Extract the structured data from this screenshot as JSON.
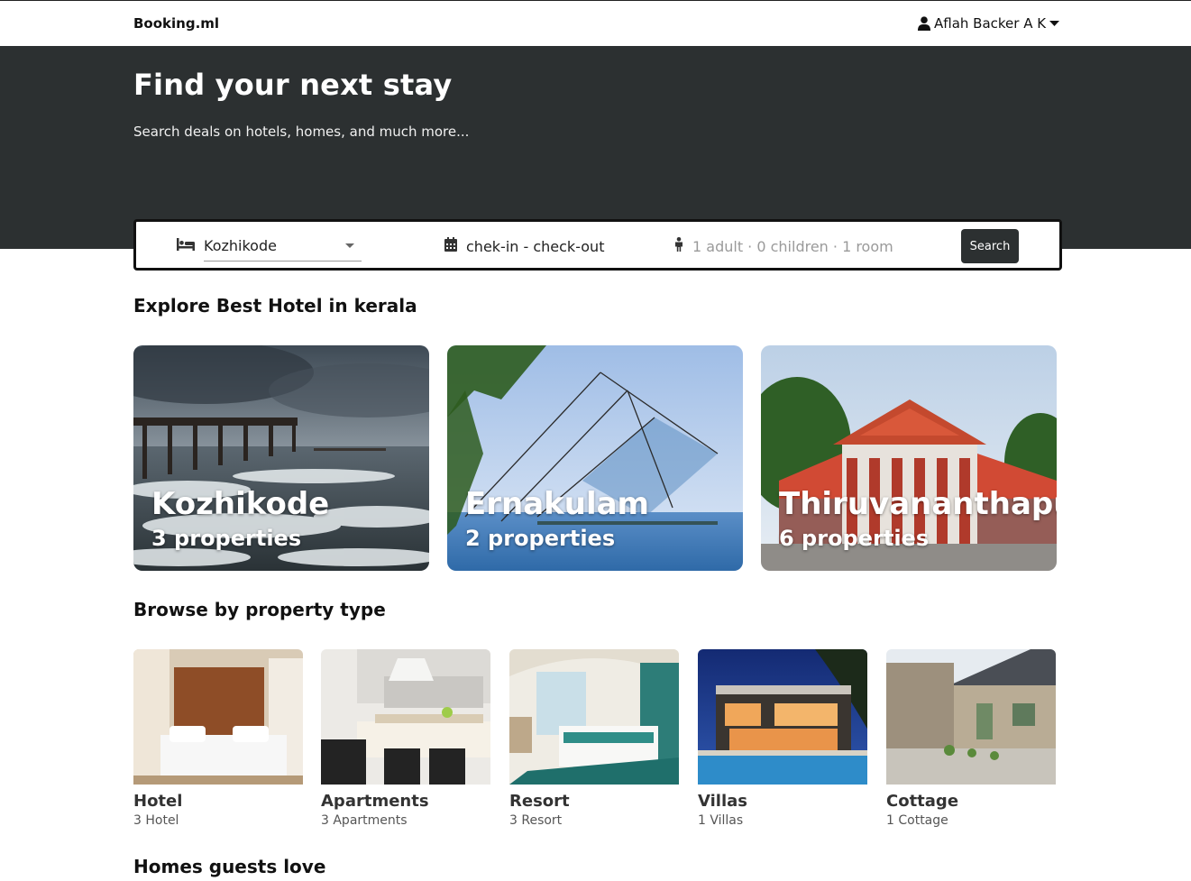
{
  "navbar": {
    "brand": "Booking.ml",
    "user_name": "Aflah Backer A K",
    "user_icon": "user-icon",
    "dropdown_icon": "caret-down-icon"
  },
  "hero": {
    "title": "Find your next stay",
    "subtitle": "Search deals on hotels, homes, and much more..."
  },
  "search": {
    "destination_icon": "bed-icon",
    "destination_value": "Kozhikode",
    "date_icon": "calendar-icon",
    "date_value": "chek-in - check-out",
    "guests_icon": "person-icon",
    "guests_placeholder": "1 adult · 0 children · 1 room",
    "search_label": "Search"
  },
  "cities_section": {
    "title": "Explore Best Hotel in kerala",
    "cities": [
      {
        "name": "Kozhikode",
        "count": "3 properties"
      },
      {
        "name": "Ernakulam",
        "count": "2 properties"
      },
      {
        "name": "Thiruvananthapuram",
        "count": "6 properties"
      }
    ]
  },
  "types_section": {
    "title": "Browse by property type",
    "types": [
      {
        "name": "Hotel",
        "count": "3 Hotel"
      },
      {
        "name": "Apartments",
        "count": "3 Apartments"
      },
      {
        "name": "Resort",
        "count": "3 Resort"
      },
      {
        "name": "Villas",
        "count": "1 Villas"
      },
      {
        "name": "Cottage",
        "count": "1 Cottage"
      }
    ]
  },
  "homes_section": {
    "title": "Homes guests love"
  },
  "colors": {
    "hero_bg": "#2c3031",
    "button_bg": "#2c3031",
    "text": "#111111"
  }
}
